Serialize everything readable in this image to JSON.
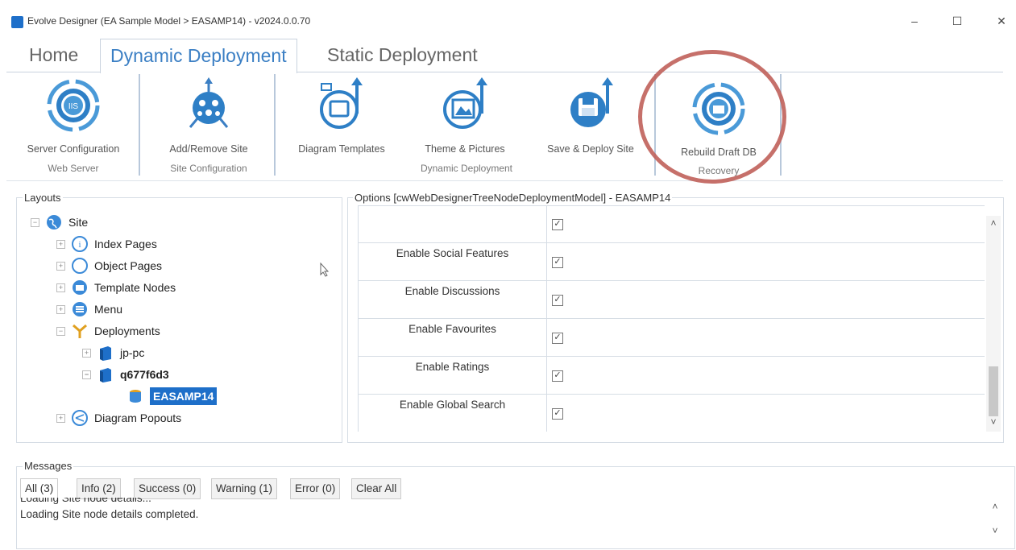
{
  "window": {
    "title": "Evolve Designer (EA Sample Model > EASAMP14) - v2024.0.0.70",
    "controls": {
      "minimize": "–",
      "maximize": "☐",
      "close": "✕"
    }
  },
  "tabs": [
    {
      "label": "Home",
      "active": false
    },
    {
      "label": "Dynamic Deployment",
      "active": true
    },
    {
      "label": "Static Deployment",
      "active": false
    }
  ],
  "ribbon": {
    "buttons": [
      {
        "label": "Server Configuration",
        "icon": "iis-icon"
      },
      {
        "label": "Add/Remove Site",
        "icon": "network-icon"
      },
      {
        "label": "Diagram Templates",
        "icon": "diagram-templates-icon"
      },
      {
        "label": "Theme & Pictures",
        "icon": "picture-icon"
      },
      {
        "label": "Save & Deploy Site",
        "icon": "save-deploy-icon"
      },
      {
        "label": "Rebuild Draft DB",
        "icon": "database-rebuild-icon"
      }
    ],
    "groups": [
      "Web Server",
      "Site Configuration",
      "Dynamic Deployment",
      "Recovery"
    ]
  },
  "layouts": {
    "legend": "Layouts",
    "tree": [
      {
        "label": "Site",
        "level": 0,
        "expander": "−"
      },
      {
        "label": "Index Pages",
        "level": 1,
        "expander": "+"
      },
      {
        "label": "Object Pages",
        "level": 1,
        "expander": "+"
      },
      {
        "label": "Template Nodes",
        "level": 1,
        "expander": "+"
      },
      {
        "label": "Menu",
        "level": 1,
        "expander": "+"
      },
      {
        "label": "Deployments",
        "level": 1,
        "expander": "−"
      },
      {
        "label": "jp-pc",
        "level": 2,
        "expander": "+"
      },
      {
        "label": "q677f6d3",
        "level": 2,
        "expander": "−"
      },
      {
        "label": "EASAMP14",
        "level": 3,
        "expander": "",
        "selected": true
      },
      {
        "label": "Diagram Popouts",
        "level": 1,
        "expander": "+"
      }
    ]
  },
  "options": {
    "legend": "Options [cwWebDesignerTreeNodeDeploymentModel] - EASAMP14",
    "rows": [
      {
        "name": "",
        "checked": true
      },
      {
        "name": "Enable Social Features",
        "checked": true
      },
      {
        "name": "Enable Discussions",
        "checked": true
      },
      {
        "name": "Enable Favourites",
        "checked": true
      },
      {
        "name": "Enable Ratings",
        "checked": true
      },
      {
        "name": "Enable Global Search",
        "checked": true
      }
    ],
    "scroll_up": "˄",
    "scroll_down": "˅"
  },
  "messages": {
    "legend": "Messages",
    "tabs": [
      "All (3)",
      "Info (2)",
      "Success (0)",
      "Warning (1)",
      "Error (0)",
      "Clear All"
    ],
    "lines": [
      "Loading Site node details...",
      "Loading Site node details completed."
    ],
    "scroll_up": "˄",
    "scroll_down": "˅"
  },
  "colors": {
    "accent": "#3b7fc4",
    "selection": "#1e6fc9",
    "highlight_circle": "#c0605a"
  }
}
